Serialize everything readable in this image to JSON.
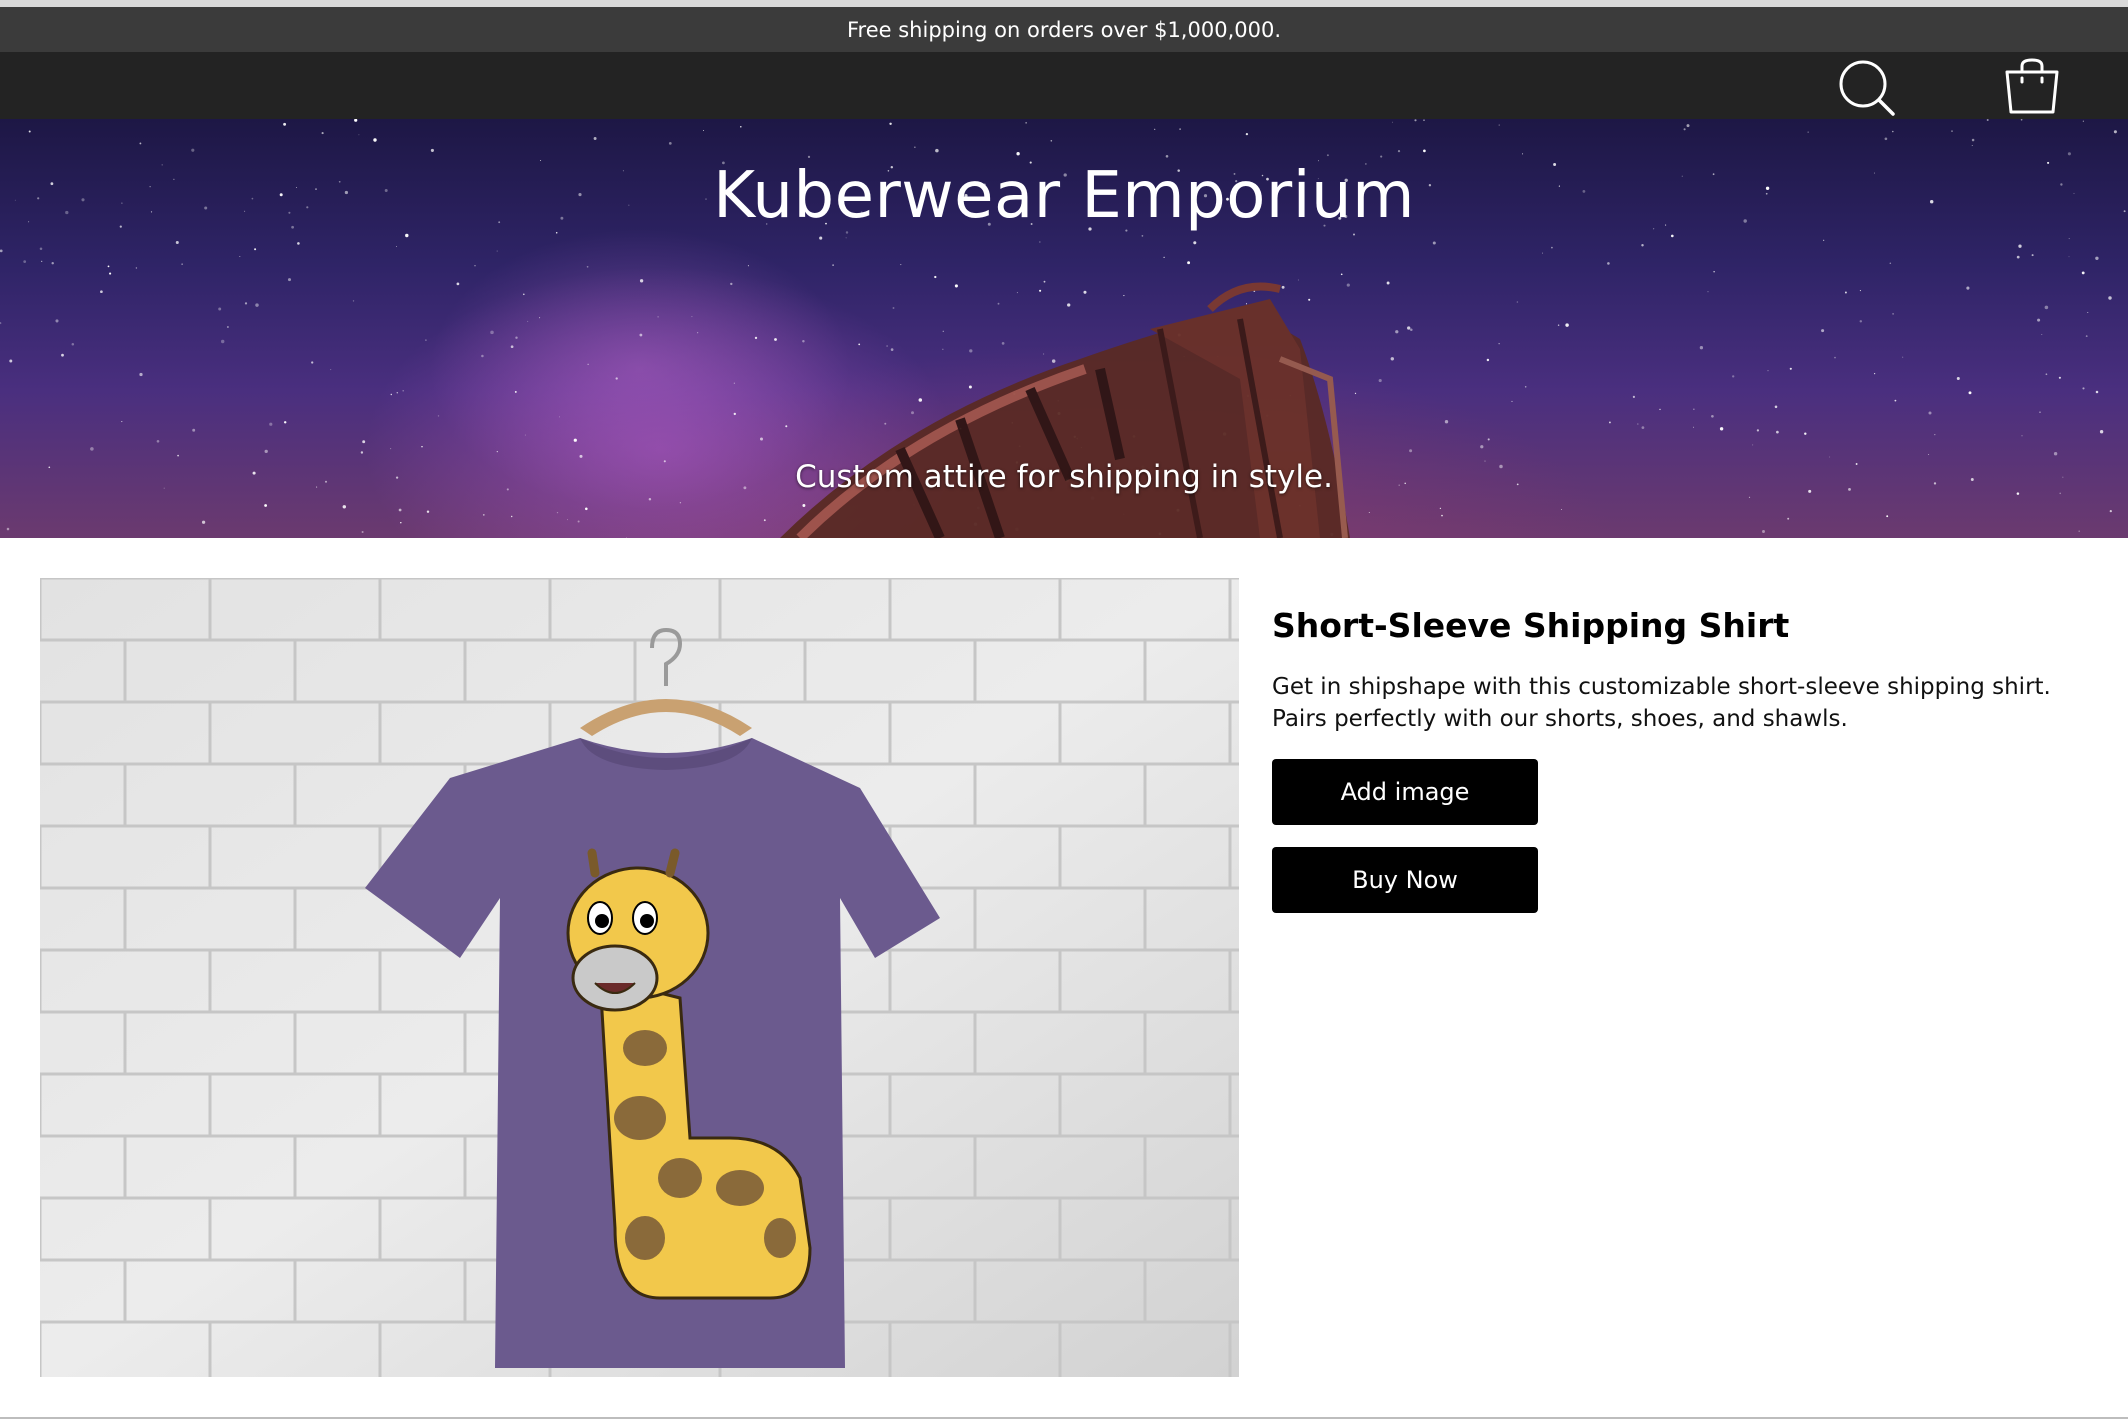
{
  "announcement": {
    "text": "Free shipping on orders over $1,000,000."
  },
  "nav": {
    "search_icon": "search-icon",
    "cart_icon": "shopping-bag-icon"
  },
  "hero": {
    "title": "Kuberwear Emporium",
    "subtitle": "Custom attire for shipping in style."
  },
  "product": {
    "title": "Short-Sleeve Shipping Shirt",
    "description": "Get in shipshape with this customizable short-sleeve shipping shirt. Pairs perfectly with our shorts, shoes, and shawls.",
    "add_image_label": "Add image",
    "buy_now_label": "Buy Now"
  },
  "colors": {
    "announcement_bg": "#3b3b3b",
    "nav_bg": "#232323",
    "button_bg": "#000000",
    "shirt": "#6b5a8e",
    "giraffe": "#f2c84b"
  }
}
